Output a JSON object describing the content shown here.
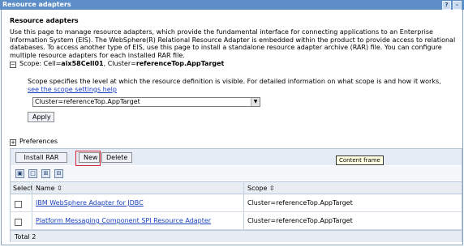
{
  "window": {
    "title": "Resource adapters",
    "help_label": "?",
    "minimize_label": "-"
  },
  "page": {
    "heading": "Resource adapters",
    "description": "Use this page to manage resource adapters, which provide the fundamental interface for connecting applications to an Enterprise Information System (EIS). The WebSphere(R) Relational Resource Adapter is embedded within the product to provide access to relational databases. To access another type of EIS, use this page to install a standalone resource adapter archive (RAR) file. You can configure multiple resource adapters for each installed RAR file."
  },
  "scope": {
    "toggle": "−",
    "label": "Scope: Cell=",
    "cell": "aix58Cell01",
    "cluster_label": ", Cluster=",
    "cluster": "referenceTop.AppTarget",
    "desc_prefix": "Scope specifies the level at which the resource definition is visible. For detailed information on what scope is and how it works, ",
    "desc_link": "see the scope settings help",
    "selected": "Cluster=referenceTop.AppTarget",
    "apply_label": "Apply"
  },
  "preferences": {
    "toggle": "+",
    "label": "Preferences"
  },
  "toolbar": {
    "install_label": "Install RAR",
    "new_label": "New",
    "delete_label": "Delete",
    "tooltip": "Content frame",
    "icons": [
      "select-all-icon",
      "deselect-all-icon",
      "filter-icon",
      "clear-filter-icon"
    ]
  },
  "table": {
    "columns": [
      "Select",
      "Name ⇳",
      "Scope ⇳"
    ],
    "rows": [
      {
        "name": "IBM WebSphere Adapter for JDBC",
        "scope": "Cluster=referenceTop.AppTarget"
      },
      {
        "name": "Platform Messaging Component SPI Resource Adapter",
        "scope": "Cluster=referenceTop.AppTarget"
      }
    ],
    "total": "Total 2"
  }
}
